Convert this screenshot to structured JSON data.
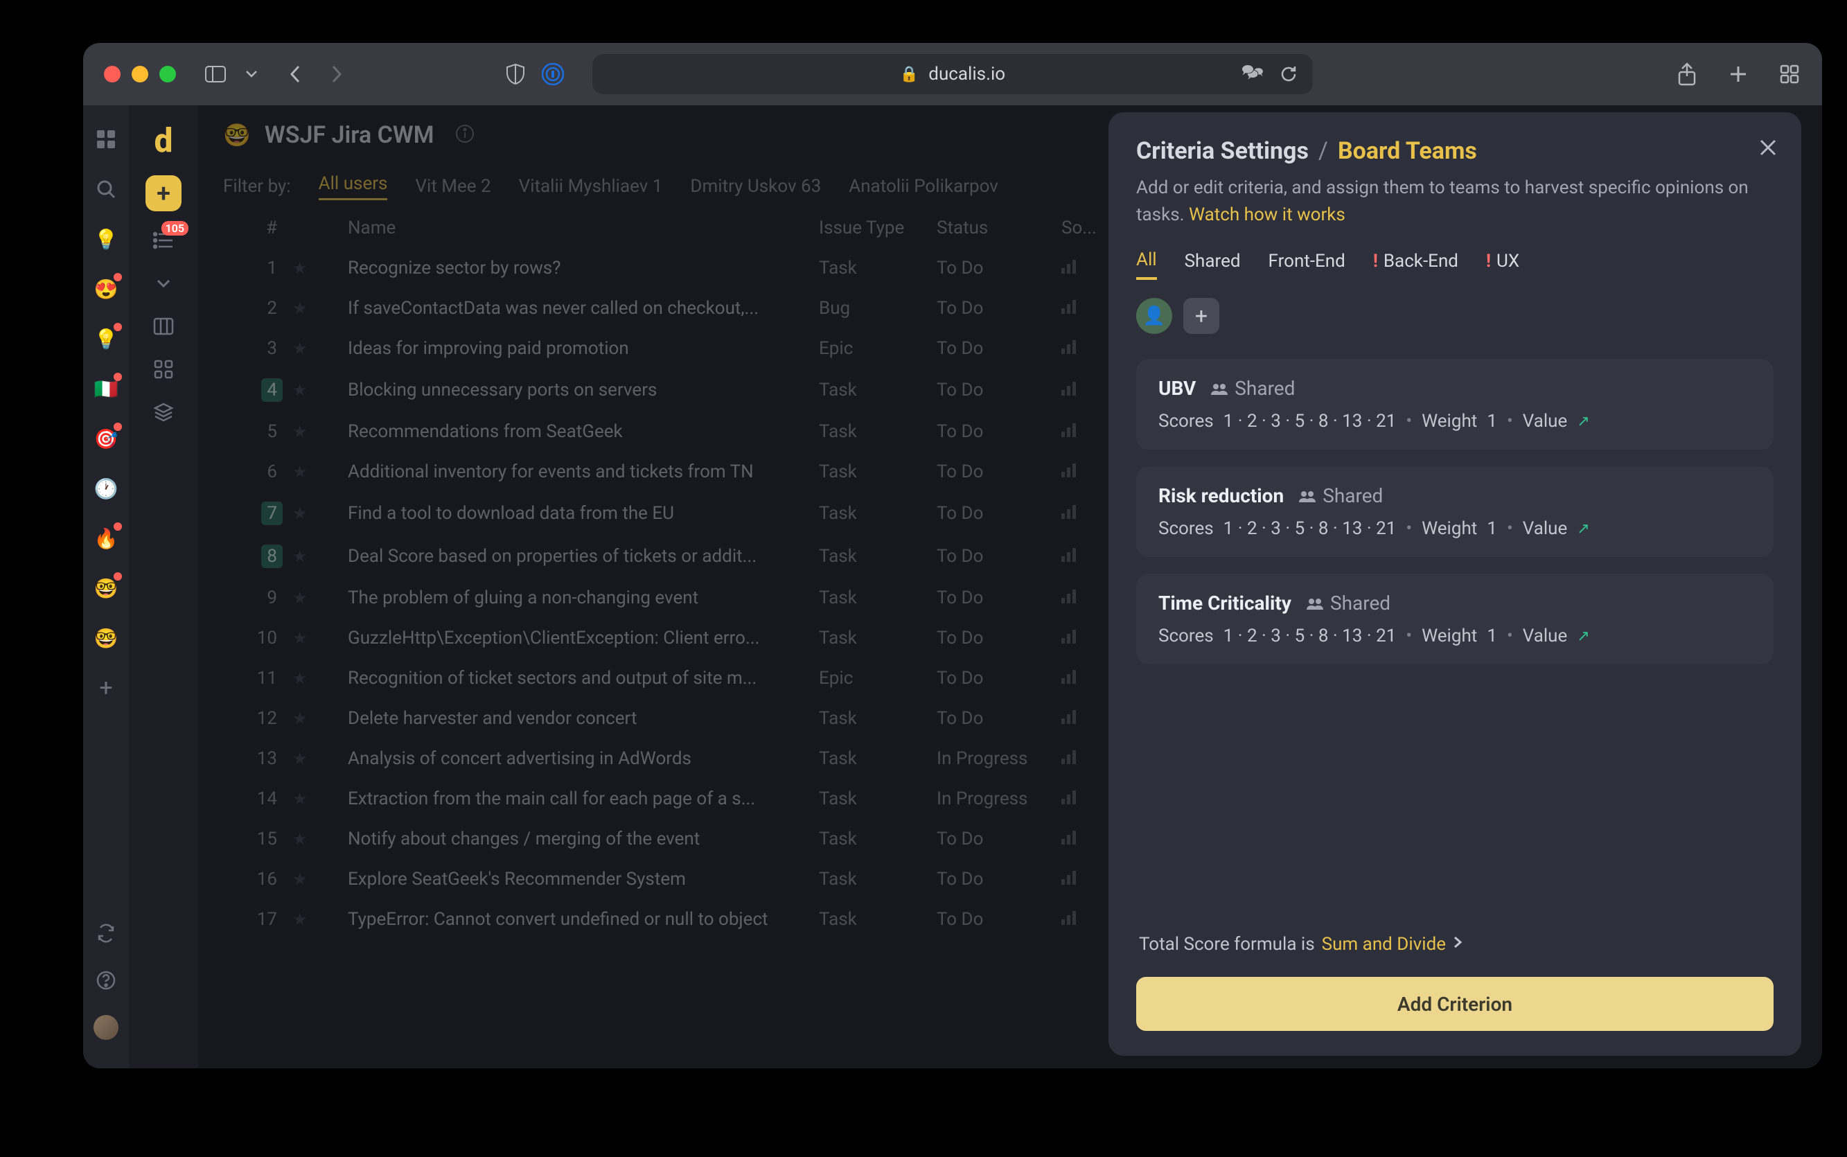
{
  "browser": {
    "domain": "ducalis.io"
  },
  "sidebar_icons": [
    "grid",
    "search",
    "bulb",
    "heart-eyes",
    "bulb2",
    "flag",
    "target",
    "clock",
    "fire",
    "glasses",
    "face"
  ],
  "rail2": {
    "badge_count": "105"
  },
  "header": {
    "board_emoji": "🤓",
    "board_title": "WSJF Jira CWM"
  },
  "filter": {
    "label": "Filter by:",
    "items": [
      "All users",
      "Vit Mee 2",
      "Vitalii Myshliaev 1",
      "Dmitry Uskov 63",
      "Anatolii Polikarpov"
    ],
    "active_index": 0
  },
  "table": {
    "columns": [
      "#",
      "Name",
      "Issue Type",
      "Status",
      "So..."
    ],
    "rows": [
      {
        "num": "1",
        "hl": false,
        "name": "Recognize sector by rows?",
        "type": "Task",
        "status": "To Do"
      },
      {
        "num": "2",
        "hl": false,
        "name": "If saveContactData was never called on checkout,...",
        "type": "Bug",
        "status": "To Do"
      },
      {
        "num": "3",
        "hl": false,
        "name": "Ideas for improving paid promotion",
        "type": "Epic",
        "status": "To Do"
      },
      {
        "num": "4",
        "hl": true,
        "name": "Blocking unnecessary ports on servers",
        "type": "Task",
        "status": "To Do"
      },
      {
        "num": "5",
        "hl": false,
        "name": "Recommendations from SeatGeek",
        "type": "Task",
        "status": "To Do"
      },
      {
        "num": "6",
        "hl": false,
        "name": "Additional inventory for events and tickets from TN",
        "type": "Task",
        "status": "To Do"
      },
      {
        "num": "7",
        "hl": true,
        "name": "Find a tool to download data from the EU",
        "type": "Task",
        "status": "To Do"
      },
      {
        "num": "8",
        "hl": true,
        "name": "Deal Score based on properties of tickets or addit...",
        "type": "Task",
        "status": "To Do"
      },
      {
        "num": "9",
        "hl": false,
        "name": "The problem of gluing a non-changing event",
        "type": "Task",
        "status": "To Do"
      },
      {
        "num": "10",
        "hl": false,
        "name": "GuzzleHttp\\Exception\\ClientException: Client erro...",
        "type": "Task",
        "status": "To Do"
      },
      {
        "num": "11",
        "hl": false,
        "name": "Recognition of ticket sectors and output of site m...",
        "type": "Epic",
        "status": "To Do"
      },
      {
        "num": "12",
        "hl": false,
        "name": "Delete harvester and vendor concert",
        "type": "Task",
        "status": "To Do"
      },
      {
        "num": "13",
        "hl": false,
        "name": "Analysis of concert advertising in AdWords",
        "type": "Task",
        "status": "In Progress"
      },
      {
        "num": "14",
        "hl": false,
        "name": "Extraction from the main call for each page of a s...",
        "type": "Task",
        "status": "In Progress"
      },
      {
        "num": "15",
        "hl": false,
        "name": "Notify about changes / merging of the event",
        "type": "Task",
        "status": "To Do"
      },
      {
        "num": "16",
        "hl": false,
        "name": "Explore SeatGeek's Recommender System",
        "type": "Task",
        "status": "To Do"
      },
      {
        "num": "17",
        "hl": false,
        "name": "TypeError: Cannot convert undefined or null to object",
        "type": "Task",
        "status": "To Do"
      }
    ]
  },
  "panel": {
    "title": "Criteria Settings",
    "subtitle": "Board Teams",
    "description": "Add or edit criteria, and assign them to teams to harvest specific opinions on tasks.",
    "link_text": "Watch how it works",
    "tabs": [
      {
        "label": "All",
        "warn": false,
        "active": true
      },
      {
        "label": "Shared",
        "warn": false,
        "active": false
      },
      {
        "label": "Front-End",
        "warn": false,
        "active": false
      },
      {
        "label": "Back-End",
        "warn": true,
        "active": false
      },
      {
        "label": "UX",
        "warn": true,
        "active": false
      }
    ],
    "criteria": [
      {
        "name": "UBV",
        "shared": "Shared",
        "scores": "1 · 2 · 3 · 5 · 8 · 13 · 21",
        "weight": "1",
        "value": "Value"
      },
      {
        "name": "Risk reduction",
        "shared": "Shared",
        "scores": "1 · 2 · 3 · 5 · 8 · 13 · 21",
        "weight": "1",
        "value": "Value"
      },
      {
        "name": "Time Criticality",
        "shared": "Shared",
        "scores": "1 · 2 · 3 · 5 · 8 · 13 · 21",
        "weight": "1",
        "value": "Value"
      }
    ],
    "formula_prefix": "Total Score formula is",
    "formula_link": "Sum and Divide",
    "add_button": "Add Criterion",
    "scores_label": "Scores",
    "weight_label": "Weight"
  }
}
